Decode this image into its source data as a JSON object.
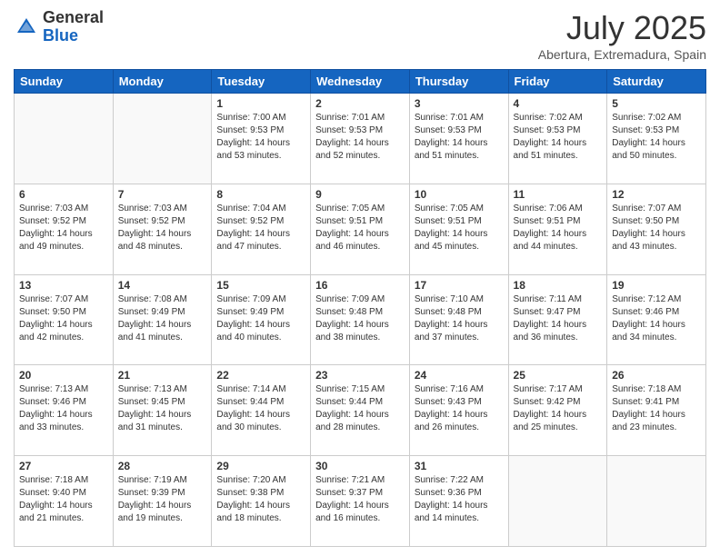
{
  "header": {
    "logo": {
      "line1": "General",
      "line2": "Blue"
    },
    "title": "July 2025",
    "location": "Abertura, Extremadura, Spain"
  },
  "weekdays": [
    "Sunday",
    "Monday",
    "Tuesday",
    "Wednesday",
    "Thursday",
    "Friday",
    "Saturday"
  ],
  "weeks": [
    [
      {
        "day": "",
        "empty": true
      },
      {
        "day": "",
        "empty": true
      },
      {
        "day": "1",
        "sunrise": "7:00 AM",
        "sunset": "9:53 PM",
        "daylight": "14 hours and 53 minutes."
      },
      {
        "day": "2",
        "sunrise": "7:01 AM",
        "sunset": "9:53 PM",
        "daylight": "14 hours and 52 minutes."
      },
      {
        "day": "3",
        "sunrise": "7:01 AM",
        "sunset": "9:53 PM",
        "daylight": "14 hours and 51 minutes."
      },
      {
        "day": "4",
        "sunrise": "7:02 AM",
        "sunset": "9:53 PM",
        "daylight": "14 hours and 51 minutes."
      },
      {
        "day": "5",
        "sunrise": "7:02 AM",
        "sunset": "9:53 PM",
        "daylight": "14 hours and 50 minutes."
      }
    ],
    [
      {
        "day": "6",
        "sunrise": "7:03 AM",
        "sunset": "9:52 PM",
        "daylight": "14 hours and 49 minutes."
      },
      {
        "day": "7",
        "sunrise": "7:03 AM",
        "sunset": "9:52 PM",
        "daylight": "14 hours and 48 minutes."
      },
      {
        "day": "8",
        "sunrise": "7:04 AM",
        "sunset": "9:52 PM",
        "daylight": "14 hours and 47 minutes."
      },
      {
        "day": "9",
        "sunrise": "7:05 AM",
        "sunset": "9:51 PM",
        "daylight": "14 hours and 46 minutes."
      },
      {
        "day": "10",
        "sunrise": "7:05 AM",
        "sunset": "9:51 PM",
        "daylight": "14 hours and 45 minutes."
      },
      {
        "day": "11",
        "sunrise": "7:06 AM",
        "sunset": "9:51 PM",
        "daylight": "14 hours and 44 minutes."
      },
      {
        "day": "12",
        "sunrise": "7:07 AM",
        "sunset": "9:50 PM",
        "daylight": "14 hours and 43 minutes."
      }
    ],
    [
      {
        "day": "13",
        "sunrise": "7:07 AM",
        "sunset": "9:50 PM",
        "daylight": "14 hours and 42 minutes."
      },
      {
        "day": "14",
        "sunrise": "7:08 AM",
        "sunset": "9:49 PM",
        "daylight": "14 hours and 41 minutes."
      },
      {
        "day": "15",
        "sunrise": "7:09 AM",
        "sunset": "9:49 PM",
        "daylight": "14 hours and 40 minutes."
      },
      {
        "day": "16",
        "sunrise": "7:09 AM",
        "sunset": "9:48 PM",
        "daylight": "14 hours and 38 minutes."
      },
      {
        "day": "17",
        "sunrise": "7:10 AM",
        "sunset": "9:48 PM",
        "daylight": "14 hours and 37 minutes."
      },
      {
        "day": "18",
        "sunrise": "7:11 AM",
        "sunset": "9:47 PM",
        "daylight": "14 hours and 36 minutes."
      },
      {
        "day": "19",
        "sunrise": "7:12 AM",
        "sunset": "9:46 PM",
        "daylight": "14 hours and 34 minutes."
      }
    ],
    [
      {
        "day": "20",
        "sunrise": "7:13 AM",
        "sunset": "9:46 PM",
        "daylight": "14 hours and 33 minutes."
      },
      {
        "day": "21",
        "sunrise": "7:13 AM",
        "sunset": "9:45 PM",
        "daylight": "14 hours and 31 minutes."
      },
      {
        "day": "22",
        "sunrise": "7:14 AM",
        "sunset": "9:44 PM",
        "daylight": "14 hours and 30 minutes."
      },
      {
        "day": "23",
        "sunrise": "7:15 AM",
        "sunset": "9:44 PM",
        "daylight": "14 hours and 28 minutes."
      },
      {
        "day": "24",
        "sunrise": "7:16 AM",
        "sunset": "9:43 PM",
        "daylight": "14 hours and 26 minutes."
      },
      {
        "day": "25",
        "sunrise": "7:17 AM",
        "sunset": "9:42 PM",
        "daylight": "14 hours and 25 minutes."
      },
      {
        "day": "26",
        "sunrise": "7:18 AM",
        "sunset": "9:41 PM",
        "daylight": "14 hours and 23 minutes."
      }
    ],
    [
      {
        "day": "27",
        "sunrise": "7:18 AM",
        "sunset": "9:40 PM",
        "daylight": "14 hours and 21 minutes."
      },
      {
        "day": "28",
        "sunrise": "7:19 AM",
        "sunset": "9:39 PM",
        "daylight": "14 hours and 19 minutes."
      },
      {
        "day": "29",
        "sunrise": "7:20 AM",
        "sunset": "9:38 PM",
        "daylight": "14 hours and 18 minutes."
      },
      {
        "day": "30",
        "sunrise": "7:21 AM",
        "sunset": "9:37 PM",
        "daylight": "14 hours and 16 minutes."
      },
      {
        "day": "31",
        "sunrise": "7:22 AM",
        "sunset": "9:36 PM",
        "daylight": "14 hours and 14 minutes."
      },
      {
        "day": "",
        "empty": true
      },
      {
        "day": "",
        "empty": true
      }
    ]
  ]
}
